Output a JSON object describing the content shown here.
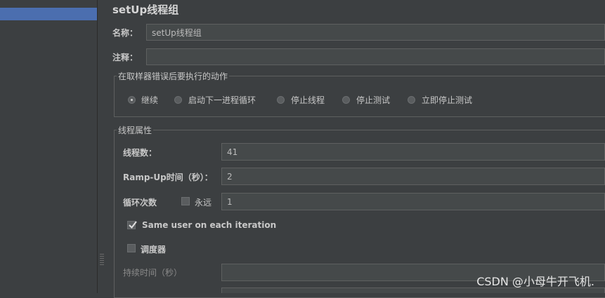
{
  "title": "setUp线程组",
  "name_label": "名称：",
  "name_value": "setUp线程组",
  "comment_label": "注释：",
  "comment_value": "",
  "error_action": {
    "group_title": "在取样器错误后要执行的动作",
    "options": [
      "继续",
      "启动下一进程循环",
      "停止线程",
      "停止测试",
      "立即停止测试"
    ],
    "selected": "继续"
  },
  "thread_props": {
    "group_title": "线程属性",
    "threads_label": "线程数：",
    "threads_value": "41",
    "rampup_label": "Ramp-Up时间（秒）：",
    "rampup_value": "2",
    "loop_label": "循环次数",
    "forever_label": "永远",
    "forever_checked": false,
    "loop_value": "1",
    "same_user_label": "Same user on each iteration",
    "same_user_checked": true,
    "scheduler_label": "调度器",
    "scheduler_checked": false,
    "duration_label": "持续时间（秒）",
    "duration_value": ""
  },
  "watermark": "CSDN @小母牛开飞机."
}
